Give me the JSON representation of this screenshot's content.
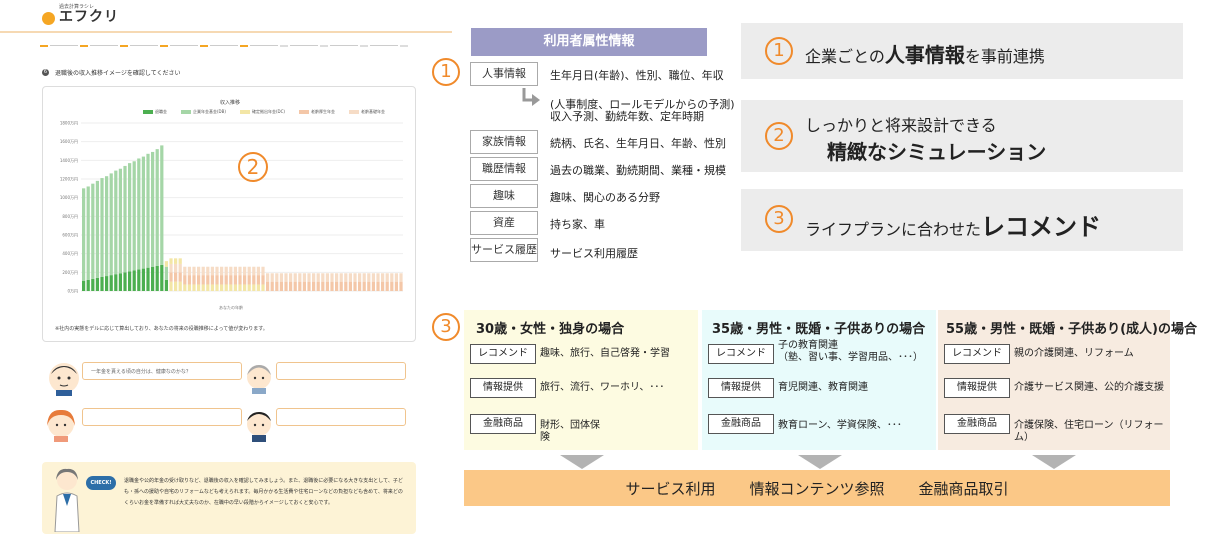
{
  "left": {
    "logo_small": "過去計算ラシレ",
    "logo_text": "エフクリ",
    "question": "退職後の収入推移イメージを確認してください",
    "chart_title": "収入推移",
    "legend": [
      "退職金",
      "企業年金基金(DB)",
      "確定拠出年金(DC)",
      "老齢厚生年金",
      "老齢基礎年金"
    ],
    "y_ticks": [
      "1800万円",
      "1600万円",
      "1400万円",
      "1200万円",
      "1000万円",
      "800万円",
      "600万円",
      "400万円",
      "200万円",
      "0万円"
    ],
    "x_axis_label": "あなたの年齢",
    "note": "※社内の実態をデルに応じて算出しており、あなたの将来の役職推移によって値が変わります。",
    "bubble1": "一年金を貰える頃の自分は、健康なのかな？",
    "check_badge": "CHECK!",
    "check_text": "退職金や公的年金の受け取りなど、退職後の収入を確認してみましょう。また、退職後に必要になる大きな支出として、子ども・孫への援助や自宅のリフォームなども考えられます。毎月かかる生活費や住宅ローンなどの負担なども含めて、将来どのくらいお金を準備すれば大丈夫なのか、在職中の早い段階からイメージしておくと安心です。",
    "circle_2": "2"
  },
  "attrs": {
    "header": "利用者属性情報",
    "circle": "1",
    "rows": [
      {
        "label": "人事情報",
        "value": "生年月日(年齢)、性別、職位、年収"
      },
      {
        "label": "",
        "value": "(人事制度、ロールモデルからの予測)"
      },
      {
        "label": "",
        "value": "収入予測、勤続年数、定年時期"
      },
      {
        "label": "家族情報",
        "value": "続柄、氏名、生年月日、年齢、性別"
      },
      {
        "label": "職歴情報",
        "value": "過去の職業、勤続期間、業種・規模"
      },
      {
        "label": "趣味",
        "value": "趣味、関心のある分野"
      },
      {
        "label": "資産",
        "value": "持ち家、車"
      },
      {
        "label": "サービス履歴",
        "value": "サービス利用履歴"
      }
    ]
  },
  "features": [
    {
      "num": "1",
      "pre": "企業ごとの",
      "bold": "人事情報",
      "post": "を事前連携"
    },
    {
      "num": "2",
      "line1": "しっかりと将来設計できる",
      "bold": "精緻なシミュレーション"
    },
    {
      "num": "3",
      "pre": "ライフプランに合わせた",
      "bold": "レコメンド"
    }
  ],
  "scenarios": {
    "circle": "3",
    "items": [
      {
        "title": "30歳・女性・独身の場合",
        "rows": [
          {
            "tag": "レコメンド",
            "value": "趣味、旅行、自己啓発・学習"
          },
          {
            "tag": "情報提供",
            "value": "旅行、流行、ワーホリ、･･･"
          },
          {
            "tag": "金融商品",
            "value": "財形、団体保\n険"
          }
        ]
      },
      {
        "title": "35歳・男性・既婚・子供ありの場合",
        "rows": [
          {
            "tag": "レコメンド",
            "value": "子の教育関連\n（塾、習い事、学習用品、･･･）"
          },
          {
            "tag": "情報提供",
            "value": "育児関連、教育関連"
          },
          {
            "tag": "金融商品",
            "value": "教育ローン、学資保険、･･･"
          }
        ]
      },
      {
        "title": "55歳・男性・既婚・子供あり(成人)の場合",
        "rows": [
          {
            "tag": "レコメンド",
            "value": "親の介護関連、リフォーム"
          },
          {
            "tag": "情報提供",
            "value": "介護サービス関連、公的介護支援"
          },
          {
            "tag": "金融商品",
            "value": "介護保険、住宅ローン（リフォーム）"
          }
        ]
      }
    ],
    "footer": [
      "サービス利用",
      "情報コンテンツ参照",
      "金融商品取引"
    ]
  },
  "colors": {
    "accent": "#f08a2b",
    "header_purple": "#9b9bc6",
    "scen1_bg": "#fdfbe1",
    "scen2_bg": "#e8fbfb",
    "scen3_bg": "#f7ebe0",
    "footer": "#fbc887"
  },
  "chart_data": {
    "type": "bar",
    "title": "収入推移",
    "xlabel": "あなたの年齢",
    "ylabel": "",
    "ylim": [
      0,
      1800
    ],
    "series": [
      {
        "name": "退職金",
        "values": [
          1100,
          1120,
          1150,
          1180,
          1210,
          1230,
          1260,
          1290,
          1310,
          1340,
          1370,
          1390,
          1420,
          1440,
          1470,
          1490,
          1520,
          1560
        ]
      },
      {
        "name": "企業年金基金(DB)",
        "values": [
          110,
          120,
          130,
          140,
          150,
          160,
          170,
          180,
          190,
          200,
          210,
          220,
          230,
          240,
          250,
          260,
          270,
          280
        ]
      }
    ],
    "categories_count": 70
  }
}
